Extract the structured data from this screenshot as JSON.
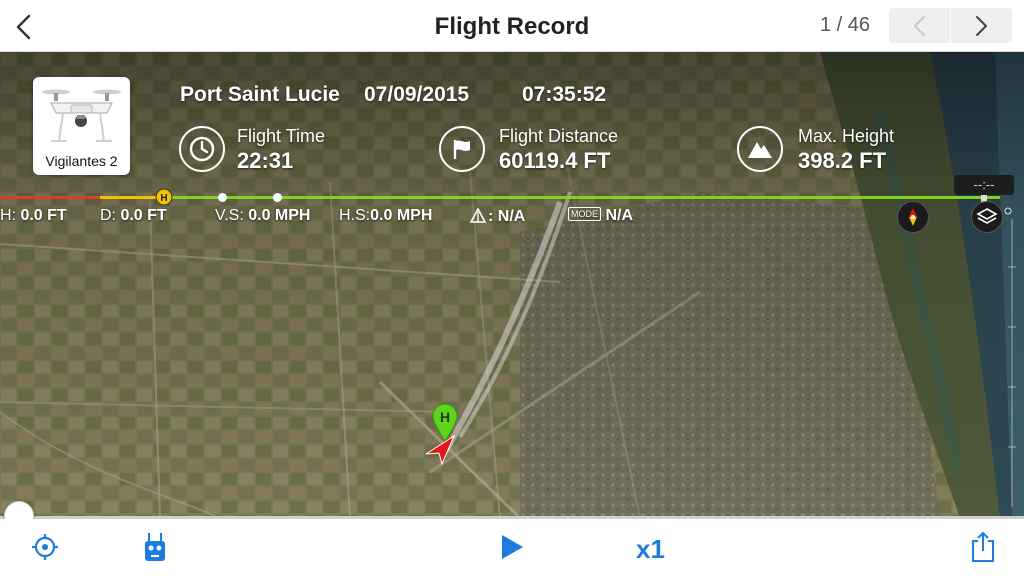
{
  "header": {
    "title": "Flight Record",
    "page_counter": "1 / 46"
  },
  "aircraft": {
    "name": "Vigilantes 2"
  },
  "flight": {
    "location": "Port Saint Lucie",
    "date": "07/09/2015",
    "time": "07:35:52"
  },
  "stats": [
    {
      "icon": "clock-icon",
      "label": "Flight Time",
      "value": "22:31"
    },
    {
      "icon": "flag-icon",
      "label": "Flight Distance",
      "value": "60119.4 FT"
    },
    {
      "icon": "mountain-icon",
      "label": "Max. Height",
      "value": "398.2 FT"
    }
  ],
  "telemetry": {
    "h_label": "H:",
    "h_value": "0.0 FT",
    "d_label": "D:",
    "d_value": "0.0 FT",
    "vs_label": "V.S:",
    "vs_value": "0.0 MPH",
    "hs_label": "H.S:",
    "hs_value": "0.0 MPH",
    "gimbal_value": "N/A",
    "mode_badge": "MODE",
    "mode_value": "N/A"
  },
  "home_marker_label": "H",
  "map_readout": "--:--",
  "playback": {
    "speed": "x1",
    "progress": 0
  },
  "colors": {
    "accent": "#1e7be0",
    "timeline_red": "#e03a2e",
    "timeline_yellow": "#f2c200",
    "timeline_green": "#7ed321",
    "home_marker": "#5ed41f",
    "aircraft_arrow": "#e0161b"
  }
}
